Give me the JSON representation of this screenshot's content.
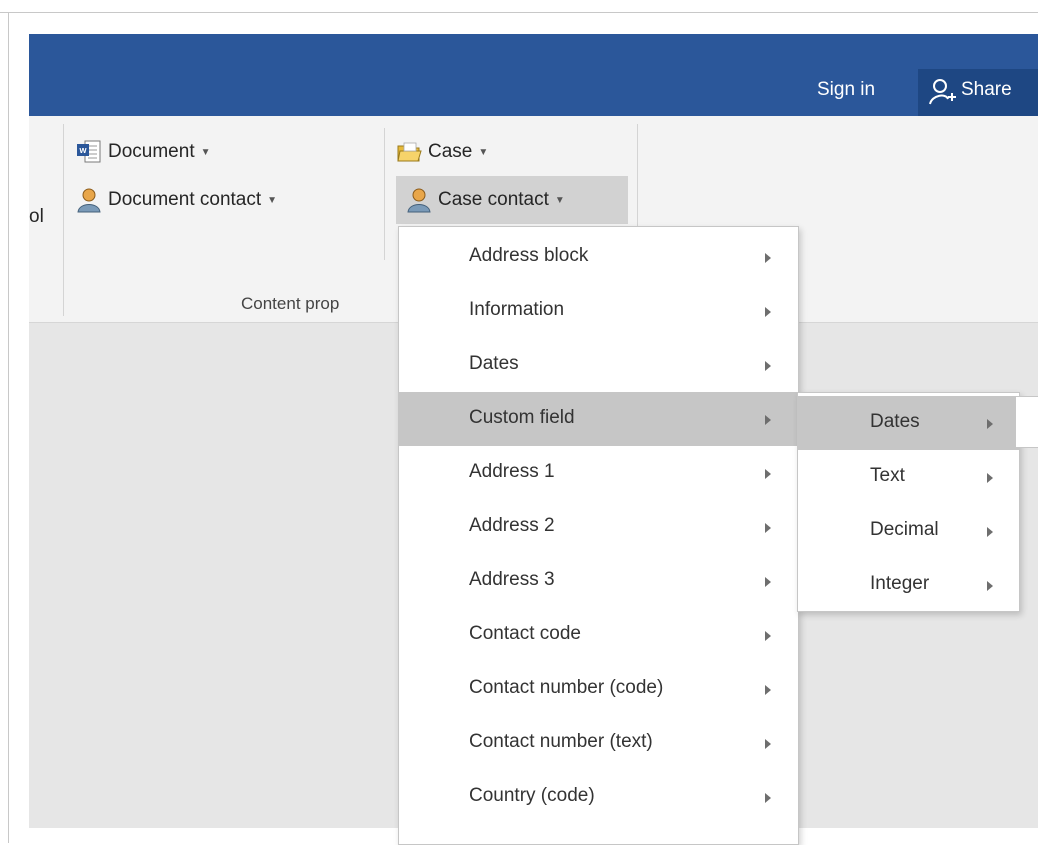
{
  "titlebar": {
    "sign_in": "Sign in",
    "share": "Share",
    "color": "#2b579a"
  },
  "ribbon": {
    "left_cut_text": "ol",
    "buttons": {
      "document": "Document",
      "document_contact": "Document contact",
      "case": "Case",
      "case_contact": "Case contact"
    },
    "group_label": "Content prop",
    "icons": [
      "word-document-icon",
      "contact-person-icon",
      "folder-icon"
    ]
  },
  "menu": {
    "items": [
      {
        "label": "Address block"
      },
      {
        "label": "Information"
      },
      {
        "label": "Dates"
      },
      {
        "label": "Custom field",
        "highlighted": true
      },
      {
        "label": "Address 1"
      },
      {
        "label": "Address 2"
      },
      {
        "label": "Address 3"
      },
      {
        "label": "Contact code"
      },
      {
        "label": "Contact number (code)"
      },
      {
        "label": "Contact number (text)"
      },
      {
        "label": "Country (code)"
      }
    ]
  },
  "submenu": {
    "items": [
      {
        "label": "Dates",
        "highlighted": true
      },
      {
        "label": "Text"
      },
      {
        "label": "Decimal"
      },
      {
        "label": "Integer"
      }
    ]
  }
}
